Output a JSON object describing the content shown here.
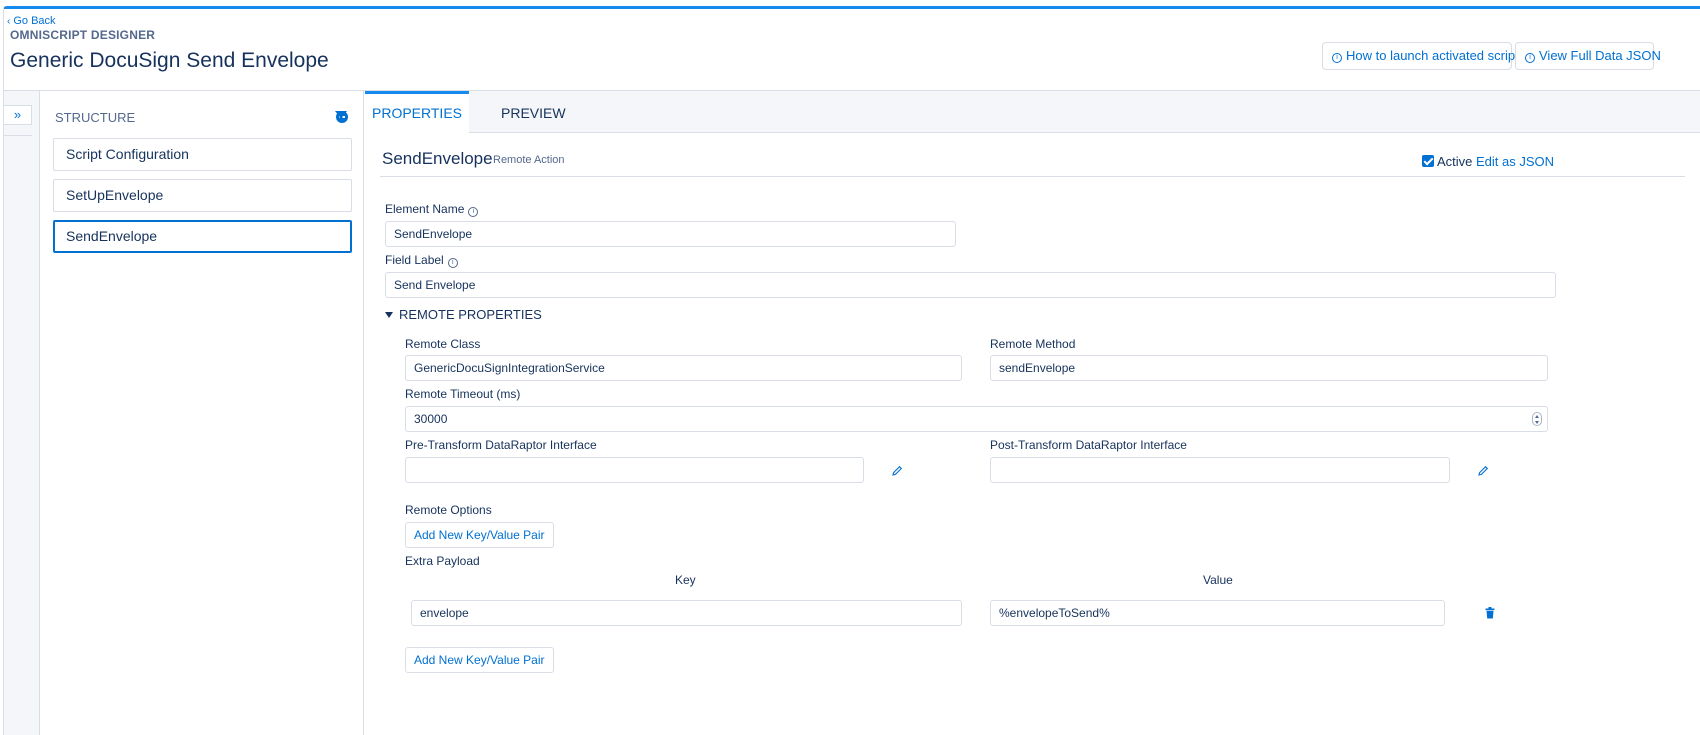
{
  "header": {
    "go_back": "Go Back",
    "designer_label": "OMNISCRIPT DESIGNER",
    "title": "Generic DocuSign Send Envelope",
    "launch_button": "How to launch activated script",
    "view_json_button": "View Full Data JSON"
  },
  "sidebar": {
    "toggle": "»"
  },
  "structure": {
    "heading": "STRUCTURE",
    "items": [
      {
        "label": "Script Configuration"
      },
      {
        "label": "SetUpEnvelope"
      },
      {
        "label": "SendEnvelope",
        "selected": true
      }
    ]
  },
  "tabs": [
    {
      "label": "PROPERTIES",
      "active": true
    },
    {
      "label": "PREVIEW"
    }
  ],
  "element": {
    "name": "SendEnvelope",
    "type": "Remote Action",
    "active_label": "Active",
    "active": true,
    "edit_json": "Edit as JSON"
  },
  "fields": {
    "element_name_label": "Element Name",
    "element_name_value": "SendEnvelope",
    "field_label_label": "Field Label",
    "field_label_value": "Send Envelope"
  },
  "remote": {
    "section_title": "REMOTE PROPERTIES",
    "class_label": "Remote Class",
    "class_value": "GenericDocuSignIntegrationService",
    "method_label": "Remote Method",
    "method_value": "sendEnvelope",
    "timeout_label": "Remote Timeout (ms)",
    "timeout_value": "30000",
    "pre_transform_label": "Pre-Transform DataRaptor Interface",
    "pre_transform_value": "",
    "post_transform_label": "Post-Transform DataRaptor Interface",
    "post_transform_value": "",
    "options_label": "Remote Options",
    "add_pair_button": "Add New Key/Value Pair",
    "extra_payload_label": "Extra Payload",
    "key_header": "Key",
    "value_header": "Value",
    "payload": [
      {
        "key": "envelope",
        "value": "%envelopeToSend%"
      }
    ],
    "add_pair_button_2": "Add New Key/Value Pair"
  },
  "colors": {
    "accent": "#0070d2",
    "top_bar": "#1589ee",
    "text": "#16325c",
    "muted": "#54698d",
    "border": "#d8dde6",
    "panel_bg": "#f4f6f9"
  }
}
